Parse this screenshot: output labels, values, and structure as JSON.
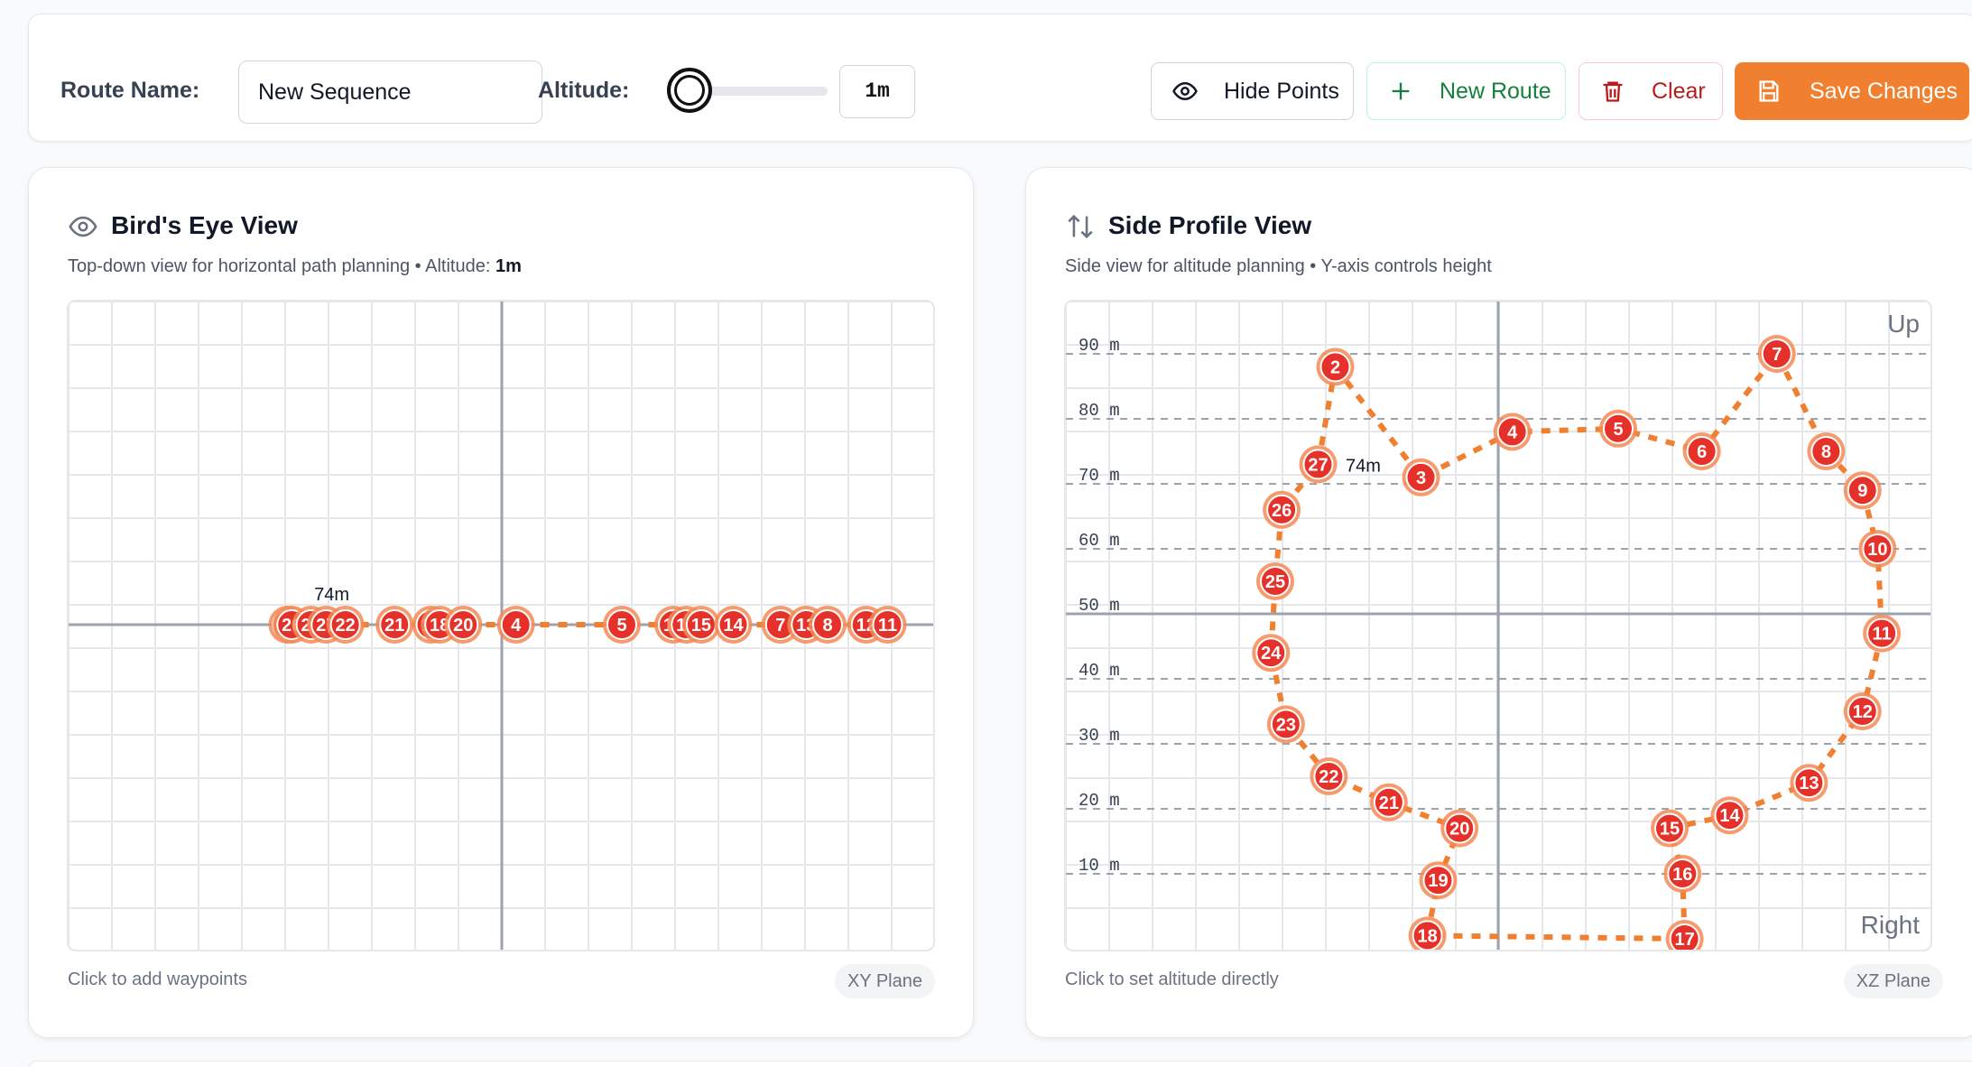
{
  "toolbar": {
    "route_name_label": "Route Name:",
    "route_name_value": "New Sequence",
    "altitude_label": "Altitude:",
    "altitude_value": "1m",
    "altitude_slider_fraction": 0.0,
    "hide_points_label": "Hide Points",
    "new_route_label": "New Route",
    "clear_label": "Clear",
    "save_label": "Save Changes"
  },
  "birds_eye": {
    "title": "Bird's Eye View",
    "subtitle_prefix": "Top-down view for horizontal path planning • Altitude: ",
    "subtitle_altitude": "1m",
    "footer": "Click to add waypoints",
    "plane_tag": "XY Plane",
    "marker_label": "74m",
    "waypoints": [
      {
        "label": "25",
        "x": -5.0
      },
      {
        "label": "26",
        "x": -4.9
      },
      {
        "label": "24",
        "x": -4.45
      },
      {
        "label": "27",
        "x": -4.1
      },
      {
        "label": "22",
        "x": -3.65
      },
      {
        "label": "21",
        "x": -2.5
      },
      {
        "label": "19",
        "x": -1.65
      },
      {
        "label": "18",
        "x": -1.45
      },
      {
        "label": "20",
        "x": -0.9
      },
      {
        "label": "4",
        "x": 0.33
      },
      {
        "label": "5",
        "x": 2.8
      },
      {
        "label": "16",
        "x": 4.0
      },
      {
        "label": "17",
        "x": 4.3
      },
      {
        "label": "15",
        "x": 4.65
      },
      {
        "label": "14",
        "x": 5.4
      },
      {
        "label": "7",
        "x": 6.5
      },
      {
        "label": "13",
        "x": 7.1
      },
      {
        "label": "8",
        "x": 7.6
      },
      {
        "label": "12",
        "x": 8.5
      },
      {
        "label": "11",
        "x": 9.0
      }
    ]
  },
  "side_profile": {
    "title": "Side Profile View",
    "subtitle": "Side view for altitude planning • Y-axis controls height",
    "footer": "Click to set altitude directly",
    "plane_tag": "XZ Plane",
    "corner_up": "Up",
    "corner_right": "Right",
    "marker_label": "74m",
    "y_ticks": [
      "90 m",
      "80 m",
      "70 m",
      "60 m",
      "50 m",
      "40 m",
      "30 m",
      "20 m",
      "10 m"
    ],
    "y_tick_values": [
      90,
      80,
      70,
      60,
      50,
      40,
      30,
      20,
      10
    ],
    "waypoints": [
      {
        "label": "2",
        "x": -3.8,
        "z": 88
      },
      {
        "label": "3",
        "x": -1.8,
        "z": 71
      },
      {
        "label": "4",
        "x": 0.33,
        "z": 78
      },
      {
        "label": "5",
        "x": 2.8,
        "z": 78.5
      },
      {
        "label": "6",
        "x": 4.75,
        "z": 75
      },
      {
        "label": "7",
        "x": 6.5,
        "z": 90
      },
      {
        "label": "8",
        "x": 7.65,
        "z": 75
      },
      {
        "label": "9",
        "x": 8.5,
        "z": 69
      },
      {
        "label": "10",
        "x": 8.85,
        "z": 60
      },
      {
        "label": "11",
        "x": 8.95,
        "z": 47
      },
      {
        "label": "12",
        "x": 8.5,
        "z": 35
      },
      {
        "label": "13",
        "x": 7.25,
        "z": 24
      },
      {
        "label": "14",
        "x": 5.4,
        "z": 19
      },
      {
        "label": "15",
        "x": 4.0,
        "z": 17
      },
      {
        "label": "16",
        "x": 4.3,
        "z": 10
      },
      {
        "label": "17",
        "x": 4.35,
        "z": 0
      },
      {
        "label": "18",
        "x": -1.65,
        "z": 0.5
      },
      {
        "label": "19",
        "x": -1.4,
        "z": 9
      },
      {
        "label": "20",
        "x": -0.9,
        "z": 17
      },
      {
        "label": "21",
        "x": -2.55,
        "z": 21
      },
      {
        "label": "22",
        "x": -3.95,
        "z": 25
      },
      {
        "label": "23",
        "x": -4.95,
        "z": 33
      },
      {
        "label": "24",
        "x": -5.3,
        "z": 44
      },
      {
        "label": "25",
        "x": -5.2,
        "z": 55
      },
      {
        "label": "26",
        "x": -5.05,
        "z": 66
      },
      {
        "label": "27",
        "x": -4.2,
        "z": 73
      }
    ]
  },
  "colors": {
    "accent": "#f07f2f",
    "waypoint_fill": "#e6302a",
    "waypoint_ring": "#f58a55",
    "path": "#f07f2f",
    "grid": "#e5e7eb",
    "axis": "#9ca3af"
  },
  "icons": {
    "hide_points": "eye-icon",
    "new_route": "plus-icon",
    "clear": "trash-icon",
    "save": "save-icon",
    "birds_eye": "eye-icon",
    "side_profile": "arrows-up-down-icon"
  }
}
